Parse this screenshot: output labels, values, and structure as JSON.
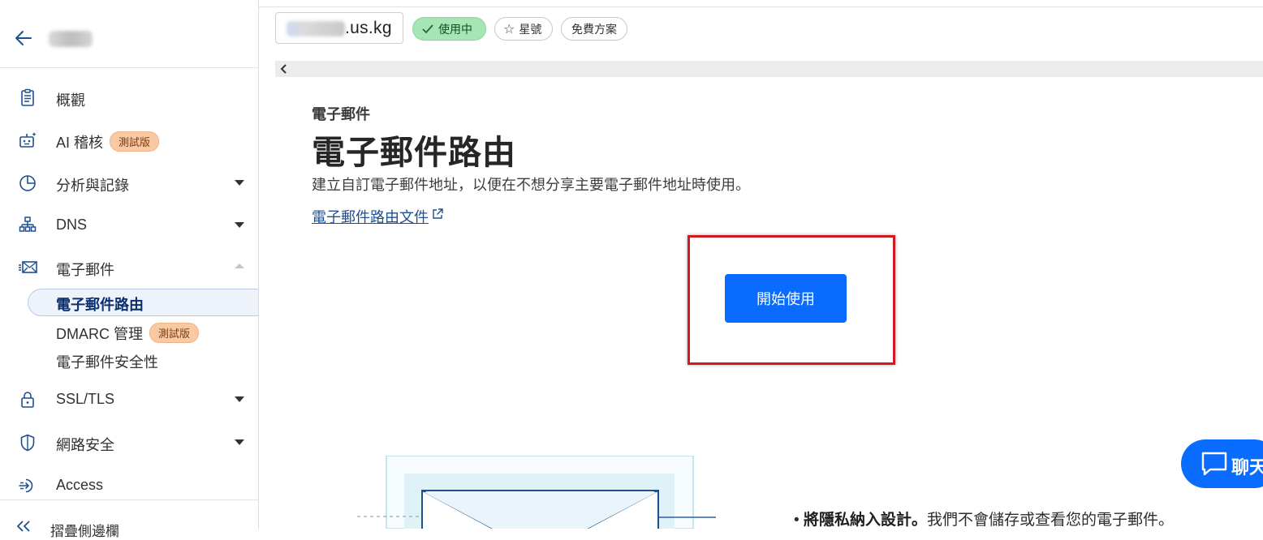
{
  "topbar": {
    "domain_suffix": ".us.kg",
    "status_label": "使用中",
    "star_label": "星號",
    "plan_label": "免費方案"
  },
  "sidebar": {
    "items": [
      {
        "label": "概觀",
        "icon": "clipboard-icon"
      },
      {
        "label": "AI 稽核",
        "icon": "robot-icon",
        "badge": "測試版"
      },
      {
        "label": "分析與記錄",
        "icon": "pie-chart-icon"
      },
      {
        "label": "DNS",
        "icon": "network-icon"
      },
      {
        "label": "電子郵件",
        "icon": "email-icon"
      },
      {
        "label": "SSL/TLS",
        "icon": "lock-icon"
      },
      {
        "label": "網路安全",
        "icon": "shield-icon"
      },
      {
        "label": "Access",
        "icon": "access-icon"
      }
    ],
    "email_sub": [
      {
        "label": "電子郵件路由",
        "active": true
      },
      {
        "label": "DMARC 管理",
        "badge": "測試版"
      },
      {
        "label": "電子郵件安全性"
      }
    ],
    "collapse_label": "摺疊側邊欄"
  },
  "main": {
    "eyebrow": "電子郵件",
    "title": "電子郵件路由",
    "description": "建立自訂電子郵件地址，以便在不想分享主要電子郵件地址時使用。",
    "doc_link": "電子郵件路由文件",
    "start_button": "開始使用",
    "bullet_bold": "將隱私納入設計。",
    "bullet_text": "我們不會儲存或查看您的電子郵件。"
  },
  "chat": {
    "label": "聊天"
  },
  "colors": {
    "accent": "#0a6cff",
    "active_badge": "#a6e6b4",
    "beta_badge": "#f9c9a4",
    "highlight": "#cf1b23"
  }
}
